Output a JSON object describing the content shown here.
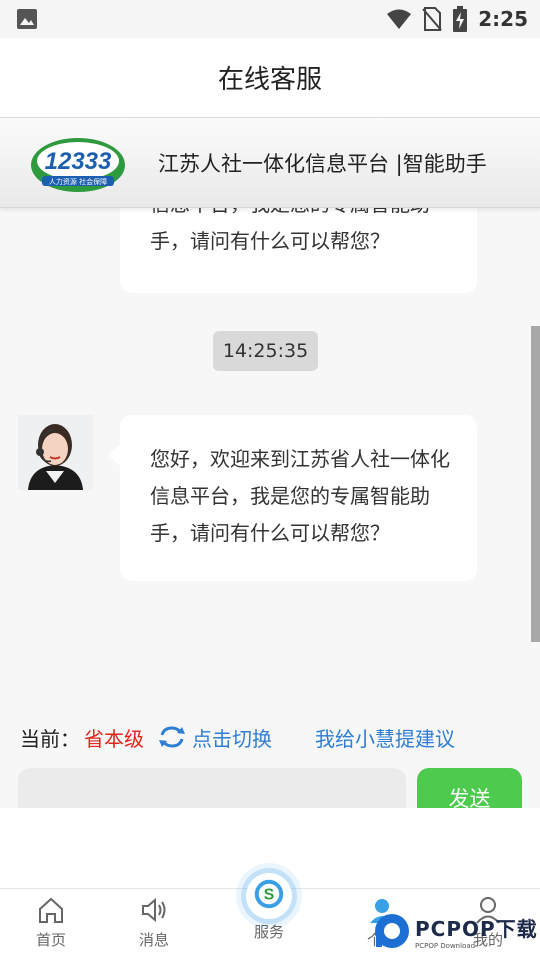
{
  "status_bar": {
    "time": "2:25"
  },
  "header": {
    "title": "在线客服"
  },
  "banner": {
    "logo_text": "12333",
    "logo_subtext": "人力资源 社会保障",
    "title": "江苏人社一体化信息平台 |智能助手"
  },
  "chat": {
    "messages": [
      {
        "lines": [
          "信息平台，我是您的专属智能助",
          "手，请问有什么可以帮您？"
        ]
      },
      {
        "timestamp": "14:25:35"
      },
      {
        "lines": [
          "您好，欢迎来到江苏省人社一体化",
          "信息平台，我是您的专属智能助",
          "手，请问有什么可以帮您？"
        ]
      }
    ]
  },
  "options": {
    "current_label": "当前：",
    "current_level": "省本级",
    "switch_label": "点击切换",
    "suggest_label": "我给小慧提建议"
  },
  "input": {
    "placeholder": "",
    "send_label": "发送"
  },
  "tabs": [
    {
      "label": "首页",
      "icon": "home-icon"
    },
    {
      "label": "消息",
      "icon": "speaker-icon"
    },
    {
      "label": "服务",
      "icon": "service-icon"
    },
    {
      "label": "个人",
      "icon": "person-icon"
    },
    {
      "label": "我的",
      "icon": "user-icon"
    }
  ],
  "watermark": {
    "text": "PCPOP下载",
    "subtext": "PCPOP Download"
  },
  "colors": {
    "accent": "#2d7ed4",
    "level": "#e0251b",
    "send": "#4ecb4e"
  }
}
